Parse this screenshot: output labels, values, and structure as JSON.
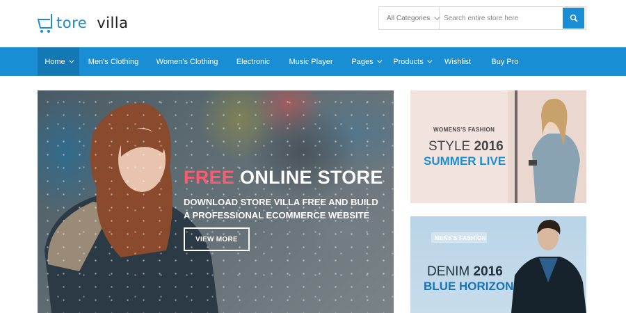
{
  "logo": {
    "part1": "tore",
    "part2": "villa"
  },
  "search": {
    "category_label": "All Categories",
    "placeholder": "Search entire store here",
    "button_icon": "search-icon"
  },
  "nav": {
    "items": [
      {
        "label": "Home",
        "dropdown": true,
        "active": true
      },
      {
        "label": "Men's Clothing",
        "dropdown": false
      },
      {
        "label": "Women's Clothing",
        "dropdown": false
      },
      {
        "label": "Electronic",
        "dropdown": false
      },
      {
        "label": "Music Player",
        "dropdown": false
      },
      {
        "label": "Pages",
        "dropdown": true
      },
      {
        "label": "Products",
        "dropdown": true
      },
      {
        "label": "Wishlist",
        "dropdown": false
      },
      {
        "label": "Buy Pro",
        "dropdown": false
      }
    ]
  },
  "hero": {
    "title_highlight": "FREE",
    "title_rest": "ONLINE STORE",
    "subtitle": "DOWNLOAD STORE VILLA FREE AND BUILD A PROFESSIONAL ECOMMERCE WEBSITE",
    "button_label": "VIEW MORE"
  },
  "banners": [
    {
      "eyebrow": "WOMENS'S FASHION",
      "line1_prefix": "STYLE",
      "line1_bold": "2016",
      "line2": "SUMMER LIVE"
    },
    {
      "eyebrow": "MENS'S FASHION",
      "line1_prefix": "DENIM",
      "line1_bold": "2016",
      "line2": "BLUE HORIZON"
    }
  ],
  "colors": {
    "accent": "#1a8ed4",
    "nav_active": "#1478b5",
    "hero_highlight": "#ff5a6e"
  }
}
